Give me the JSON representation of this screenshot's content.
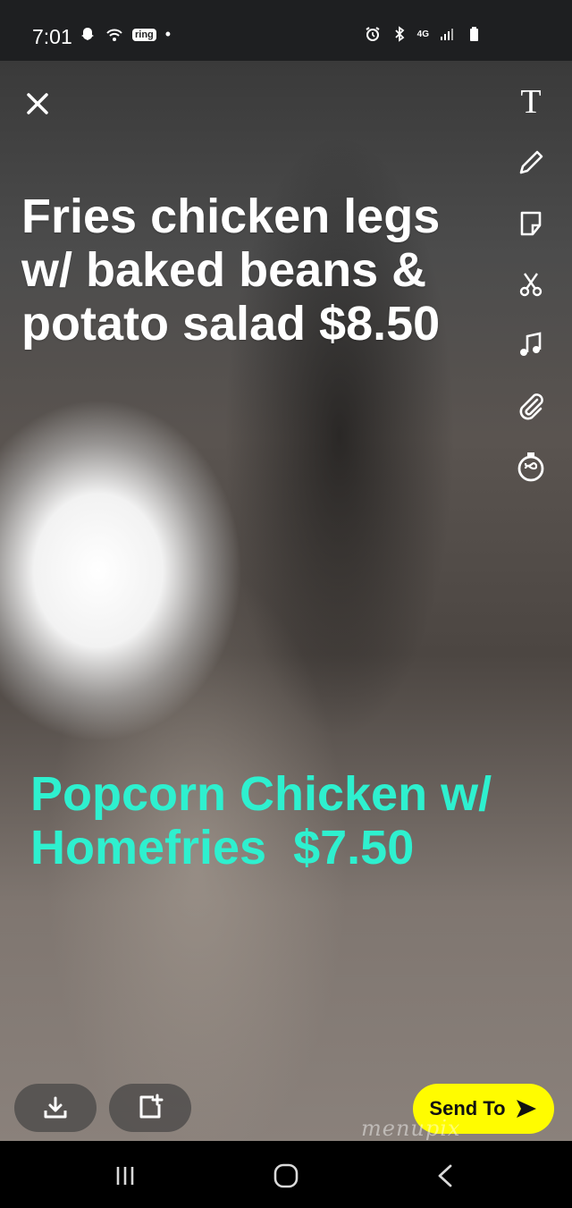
{
  "status_bar": {
    "time": "7:01",
    "ring_label": "ring",
    "dot": "•",
    "network_label": "4G"
  },
  "icons": {
    "close": "close-icon",
    "text_tool": "T",
    "pencil": "pencil-icon",
    "sticker": "sticker-icon",
    "scissors": "scissors-icon",
    "music": "music-icon",
    "paperclip": "paperclip-icon",
    "timer": "timer-icon",
    "download": "download-icon",
    "add_story": "add-story-icon",
    "send_arrow": "send-arrow-icon"
  },
  "captions": {
    "first": "Fries chicken legs w/ baked beans & potato salad $8.50",
    "second": "Popcorn Chicken w/ Homefries  $7.50"
  },
  "send_button": {
    "label": "Send To"
  },
  "watermark": "menupix",
  "colors": {
    "caption_accent": "#2ef0cf",
    "send_button_bg": "#fffc00"
  }
}
